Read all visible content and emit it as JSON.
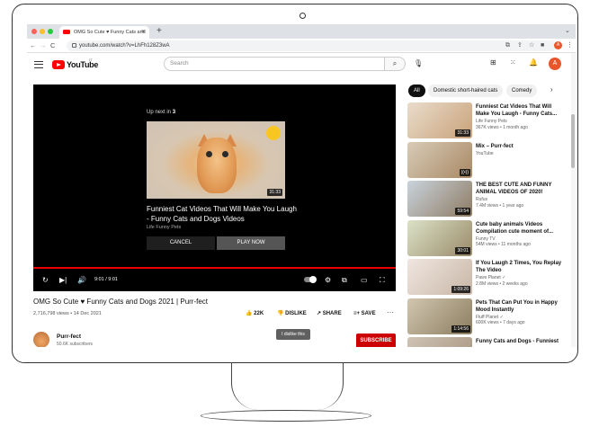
{
  "browser": {
    "tab_title": "OMG So Cute ♥ Funny Cats and",
    "tab_close": "×",
    "new_tab": "+",
    "url": "youtube.com/watch?v=LhFh128Z3wA",
    "profile": "A",
    "back": "←",
    "forward": "→",
    "reload": "C"
  },
  "header": {
    "logo_text": "YouTube",
    "region": "IT",
    "search_placeholder": "Search",
    "search_icon": "⌕",
    "avatar": "A"
  },
  "player": {
    "upnext_prefix": "Up next in",
    "upnext_count": "3",
    "next_title": "Funniest Cat Videos That Will Make You Laugh - Funny Cats and Dogs Videos",
    "next_channel": "Life Funny Pets",
    "next_duration": "31:33",
    "cancel": "CANCEL",
    "play_now": "PLAY NOW",
    "time": "9:01 / 9:01",
    "progress_fraction": 1.0
  },
  "video": {
    "title": "OMG So Cute ♥ Funny Cats and Dogs 2021 | Purr-fect",
    "meta": "2,716,798 views • 14 Dec 2021",
    "likes": "22K",
    "dislike": "DISLIKE",
    "share": "SHARE",
    "save": "SAVE",
    "more": "···",
    "channel": "Purr-fect",
    "subscribers": "50.6K subscribers",
    "subscribe": "SUBSCRIBE",
    "tooltip": "I dislike this"
  },
  "chips": [
    "All",
    "Domestic short-haired cats",
    "Comedy"
  ],
  "related": [
    {
      "title": "Funniest Cat Videos That Will Make You Laugh - Funny Cats...",
      "channel": "Life Funny Pets",
      "meta": "367K views • 1 month ago",
      "duration": "31:33"
    },
    {
      "title": "Mix – Purr-fect",
      "channel": "YouTube",
      "meta": "",
      "duration": "((•))"
    },
    {
      "title": "THE BEST CUTE AND FUNNY ANIMAL VIDEOS OF 2020!",
      "channel": "Rufus",
      "meta": "7.4M views • 1 year ago",
      "duration": "59:54"
    },
    {
      "title": "Cute baby animals Videos Compilation cute moment of...",
      "channel": "Funny TV",
      "meta": "54M views • 11 months ago",
      "duration": "30:01"
    },
    {
      "title": "If You Laugh 2 Times, You Replay The Video",
      "channel": "Paws Planet ✓",
      "meta": "2.8M views • 2 weeks ago",
      "duration": "1:09:26"
    },
    {
      "title": "Pets That Can Put You in Happy Mood Instantly",
      "channel": "Fluff Planet ✓",
      "meta": "600K views • 7 days ago",
      "duration": "1:14:56"
    },
    {
      "title": "Funny Cats and Dogs - Funniest",
      "channel": "",
      "meta": "",
      "duration": ""
    }
  ]
}
